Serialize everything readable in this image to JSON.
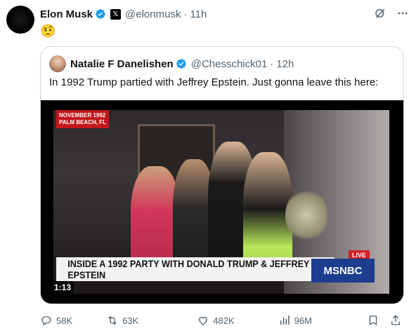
{
  "tweet": {
    "name": "Elon Musk",
    "handle": "@elonmusk",
    "time": "11h",
    "emoji": "🤨"
  },
  "quote": {
    "name": "Natalie F Danelishen",
    "handle": "@Chesschick01",
    "time": "12h",
    "text": "In 1992 Trump partied with Jeffrey Epstein. Just gonna leave this here:",
    "video": {
      "location_line1": "NOVEMBER 1992",
      "location_line2": "PALM BEACH, FL",
      "lower_third": "INSIDE A 1992 PARTY WITH DONALD TRUMP & JEFFREY EPSTEIN",
      "network": "MSNBC",
      "live": "LIVE",
      "duration": "1:13"
    }
  },
  "actions": {
    "replies": "58K",
    "reposts": "63K",
    "likes": "482K",
    "views": "96M"
  },
  "icons": {
    "verified": "verified-badge-icon",
    "x_badge": "x-logo-icon",
    "grok": "grok-icon",
    "more": "more-icon",
    "reply": "reply-icon",
    "repost": "repost-icon",
    "like": "heart-icon",
    "views": "views-icon",
    "bookmark": "bookmark-icon",
    "share": "share-icon"
  },
  "colors": {
    "verified": "#1d9bf0",
    "muted": "#536471",
    "border": "#cfd9de"
  }
}
